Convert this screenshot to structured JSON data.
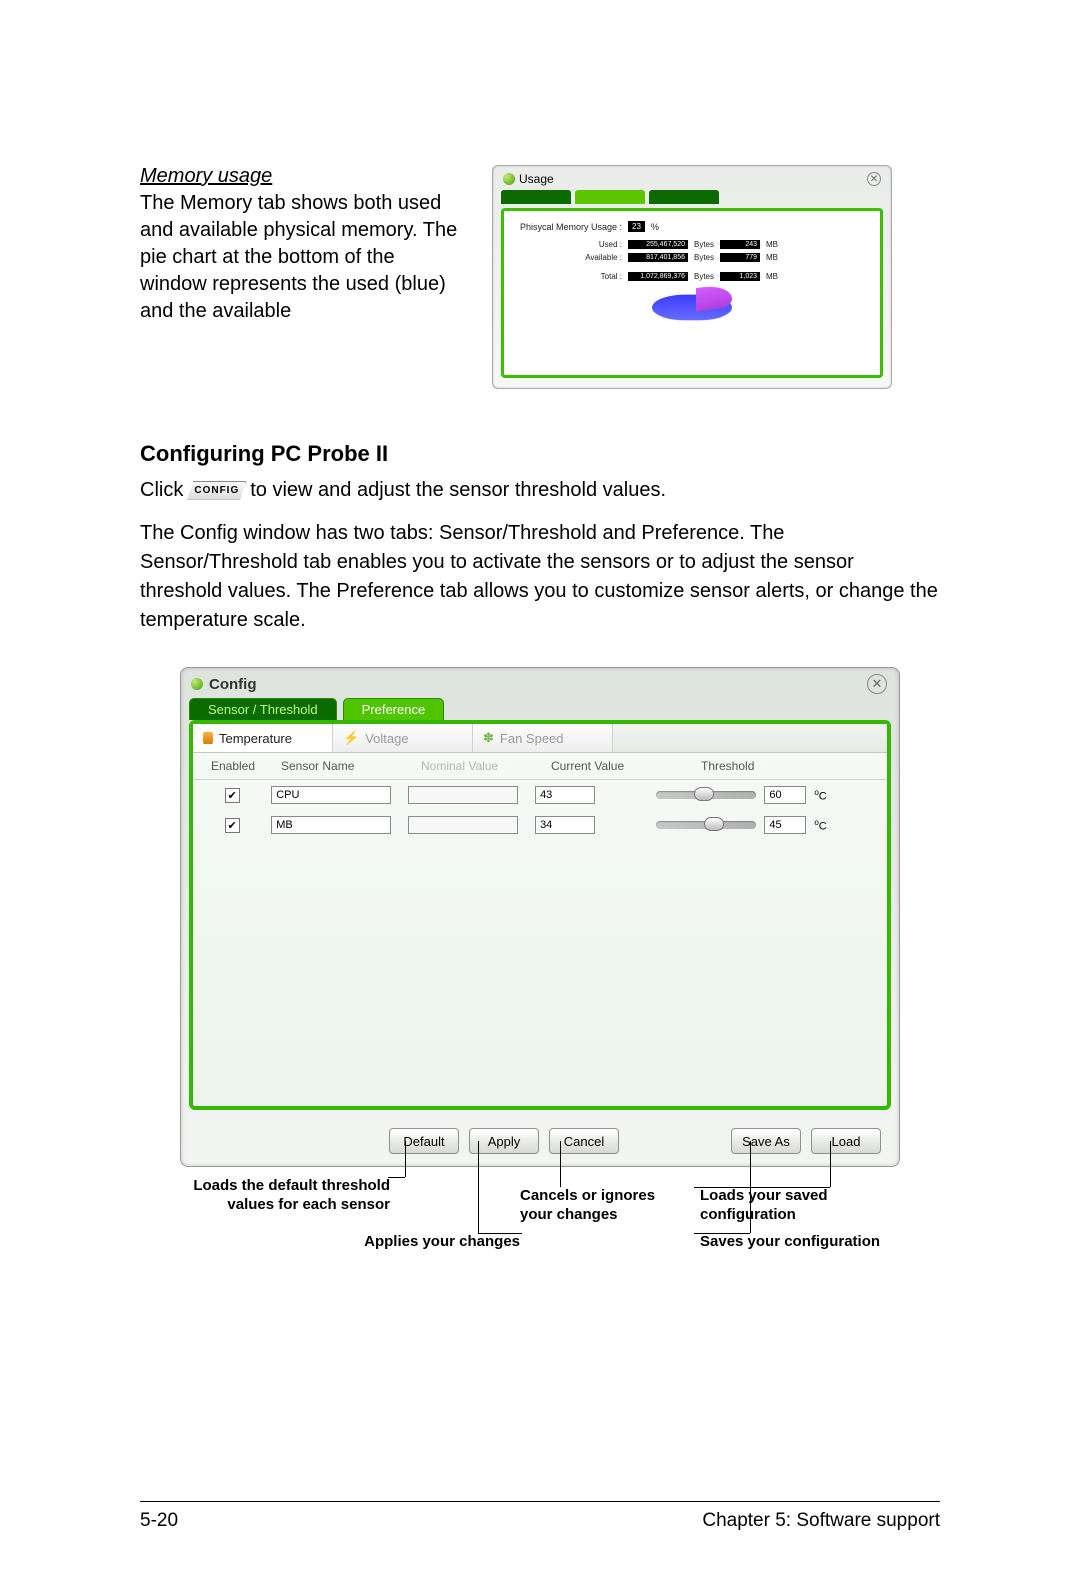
{
  "memory": {
    "heading": "Memory usage",
    "body": "The Memory tab shows both used and available physical memory. The pie chart at the bottom of the window represents the used (blue) and the available"
  },
  "usage_window": {
    "title": "Usage",
    "pmu_label": "Phisycal Memory Usage :",
    "pmu_pct": "23",
    "pmu_unit": "%",
    "rows": [
      {
        "label": "Used :",
        "bytes": "255,467,520",
        "mb": "243",
        "u1": "Bytes",
        "u2": "MB"
      },
      {
        "label": "Available :",
        "bytes": "817,401,856",
        "mb": "779",
        "u1": "Bytes",
        "u2": "MB"
      },
      {
        "label": "Total :",
        "bytes": "1,072,869,376",
        "mb": "1,023",
        "u1": "Bytes",
        "u2": "MB"
      }
    ]
  },
  "config_section": {
    "heading": "Configuring PC Probe II",
    "click_pre": "Click",
    "config_btn": "CONFIG",
    "click_post": "to view and adjust the sensor threshold values.",
    "para": "The Config window has two tabs: Sensor/Threshold and Preference. The Sensor/Threshold tab enables you to activate the sensors or to adjust the sensor threshold values. The Preference tab allows you to customize sensor alerts, or change the temperature scale."
  },
  "config_window": {
    "title": "Config",
    "main_tabs": {
      "active": "Sensor / Threshold",
      "inactive": "Preference"
    },
    "sub_tabs": [
      "Temperature",
      "Voltage",
      "Fan Speed"
    ],
    "columns": {
      "enabled": "Enabled",
      "sensor": "Sensor Name",
      "nominal": "Nominal Value",
      "current": "Current Value",
      "threshold": "Threshold"
    },
    "rows": [
      {
        "checked": true,
        "name": "CPU",
        "current": "43",
        "threshold": "60",
        "knob": 38
      },
      {
        "checked": true,
        "name": "MB",
        "current": "34",
        "threshold": "45",
        "knob": 48
      }
    ],
    "unit": "C",
    "buttons": {
      "default": "Default",
      "apply": "Apply",
      "cancel": "Cancel",
      "save_as": "Save As",
      "load": "Load"
    }
  },
  "callouts": {
    "default": "Loads the default threshold values for each sensor",
    "apply": "Applies your changes",
    "cancel": "Cancels or ignores your changes",
    "load": "Loads your saved configuration",
    "save": "Saves your configuration"
  },
  "footer": {
    "page": "5-20",
    "chapter": "Chapter 5: Software support"
  }
}
